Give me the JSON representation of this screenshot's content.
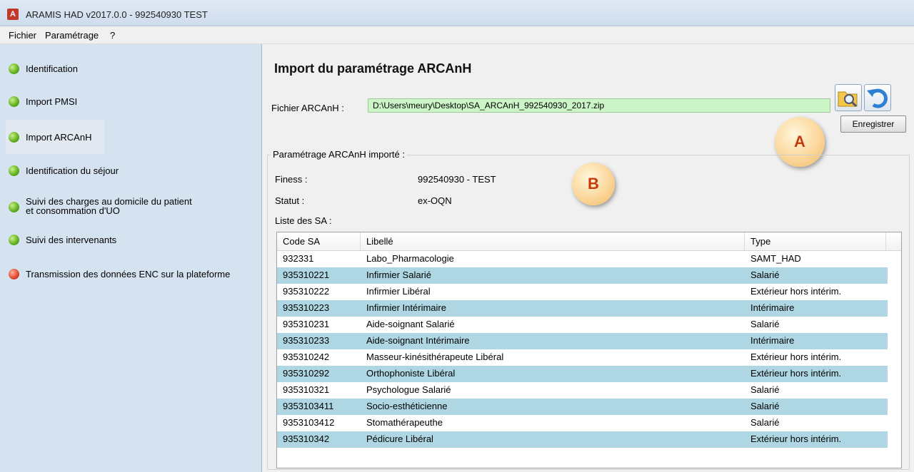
{
  "window": {
    "title": "ARAMIS HAD v2017.0.0  -  992540930  TEST",
    "app_icon": "A"
  },
  "menu": [
    "Fichier",
    "Paramétrage",
    "?"
  ],
  "sidebar": {
    "items": [
      {
        "label": "Identification",
        "status": "green"
      },
      {
        "label": "Import PMSI",
        "status": "green"
      },
      {
        "label": "Import ARCAnH",
        "status": "green"
      },
      {
        "label": "Identification du séjour",
        "status": "green"
      },
      {
        "label": "Suivi des charges au domicile du patient",
        "label2": "et consommation d'UO",
        "status": "green"
      },
      {
        "label": "Suivi des intervenants",
        "status": "green"
      },
      {
        "label": "Transmission des données ENC sur la plateforme",
        "status": "red"
      }
    ]
  },
  "main": {
    "title": "Import du paramétrage ARCAnH",
    "file_label": "Fichier ARCAnH :",
    "file_value": "D:\\Users\\meury\\Desktop\\SA_ARCAnH_992540930_2017.zip",
    "save_label": "Enregistrer",
    "badge_a": "A",
    "badge_b": "B",
    "group_title": "Paramétrage ARCAnH importé :",
    "finess_label": "Finess :",
    "finess_value": "992540930 - TEST",
    "statut_label": "Statut :",
    "statut_value": "ex-OQN",
    "list_label": "Liste des SA :",
    "columns": [
      "Code SA",
      "Libellé",
      "Type"
    ],
    "rows": [
      [
        "932331",
        "Labo_Pharmacologie",
        "SAMT_HAD"
      ],
      [
        "935310221",
        "Infirmier Salarié",
        "Salarié"
      ],
      [
        "935310222",
        "Infirmier Libéral",
        "Extérieur hors intérim."
      ],
      [
        "935310223",
        "Infirmier Intérimaire",
        "Intérimaire"
      ],
      [
        "935310231",
        "Aide-soignant Salarié",
        "Salarié"
      ],
      [
        "935310233",
        "Aide-soignant Intérimaire",
        "Intérimaire"
      ],
      [
        "935310242",
        "Masseur-kinésithérapeute Libéral",
        "Extérieur hors intérim."
      ],
      [
        "935310292",
        "Orthophoniste Libéral",
        "Extérieur hors intérim."
      ],
      [
        "935310321",
        "Psychologue Salarié",
        "Salarié"
      ],
      [
        "9353103411",
        "Socio-esthéticienne",
        "Salarié"
      ],
      [
        "9353103412",
        "Stomathérapeuthe",
        "Salarié"
      ],
      [
        "935310342",
        "Pédicure Libéral",
        "Extérieur hors intérim."
      ]
    ]
  },
  "icons": {
    "browse": "folder-search-icon",
    "undo": "undo-arrow-icon"
  },
  "colors": {
    "row_alt": "#aed7e3",
    "file_field": "#ccf5c7",
    "sidebar": "#d5e3f1"
  }
}
